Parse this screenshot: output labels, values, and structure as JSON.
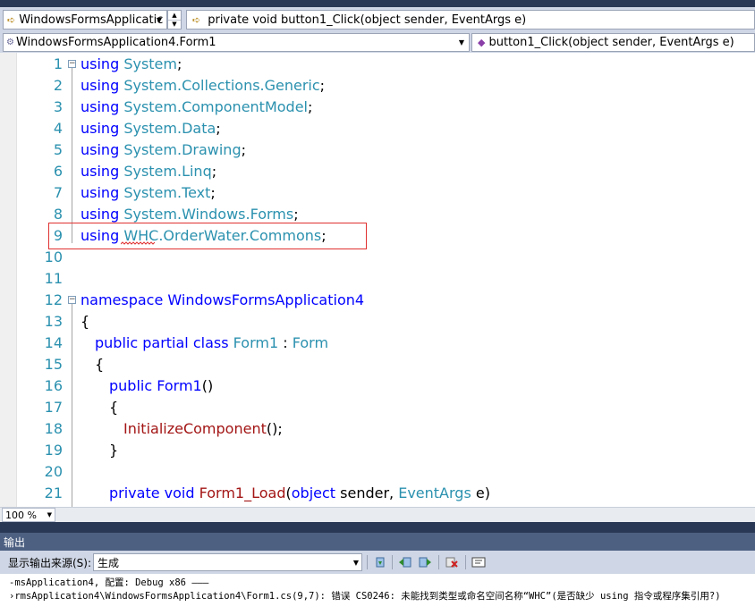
{
  "nav1": {
    "project_combo": "WindowsFormsApplicatic",
    "member_combo": "private void button1_Click(object sender, EventArgs e)"
  },
  "nav2": {
    "class_combo": "WindowsFormsApplication4.Form1",
    "method_combo": "button1_Click(object sender, EventArgs e)"
  },
  "editor": {
    "line_numbers": [
      "1",
      "2",
      "3",
      "4",
      "5",
      "6",
      "7",
      "8",
      "9",
      "10",
      "11",
      "12",
      "13",
      "14",
      "15",
      "16",
      "17",
      "18",
      "19",
      "20",
      "21"
    ],
    "lines": {
      "l1": {
        "kw": "using",
        "ns": "System",
        "end": ";"
      },
      "l2": {
        "kw": "using",
        "ns": "System.Collections.Generic",
        "end": ";"
      },
      "l3": {
        "kw": "using",
        "ns": "System.ComponentModel",
        "end": ";"
      },
      "l4": {
        "kw": "using",
        "ns": "System.Data",
        "end": ";"
      },
      "l5": {
        "kw": "using",
        "ns": "System.Drawing",
        "end": ";"
      },
      "l6": {
        "kw": "using",
        "ns": "System.Linq",
        "end": ";"
      },
      "l7": {
        "kw": "using",
        "ns": "System.Text",
        "end": ";"
      },
      "l8": {
        "kw": "using",
        "ns": "System.Windows.Forms",
        "end": ";"
      },
      "l9": {
        "kw": "using",
        "err": "WHC",
        "ns": ".OrderWater.Commons",
        "end": ";"
      },
      "l12": {
        "kw": "namespace",
        "ns": "WindowsFormsApplication4"
      },
      "l13": {
        "brace": "{"
      },
      "l14": {
        "kw1": "public",
        "kw2": "partial",
        "kw3": "class",
        "cls": "Form1",
        "sep": ":",
        "base": "Form"
      },
      "l15": {
        "brace": "{"
      },
      "l16": {
        "kw": "public",
        "fn": "Form1",
        "rest": "()"
      },
      "l17": {
        "brace": "{"
      },
      "l18": {
        "fn": "InitializeComponent",
        "rest": "();"
      },
      "l19": {
        "brace": "}"
      },
      "l21": {
        "kw1": "private",
        "kw2": "void",
        "fn": "Form1_Load",
        "p1": "(",
        "kw3": "object",
        "p2": " sender, ",
        "ty": "EventArgs",
        "p3": " e)"
      }
    }
  },
  "zoom": {
    "value": "100 %"
  },
  "output": {
    "title": "输出",
    "source_label": "显示输出来源(S):",
    "source_value": "生成",
    "line1": "-msApplication4, 配置: Debug x86 ———",
    "line2": "›rmsApplication4\\WindowsFormsApplication4\\Form1.cs(9,7): 错误 CS0246: 未能找到类型或命名空间名称“WHC”(是否缺少 using 指令或程序集引用?)"
  },
  "colors": {
    "keyword": "#0000FF",
    "type": "#2B91AF",
    "method": "#A31515",
    "line_number": "#2B91AF",
    "error_box": "#E03030"
  }
}
